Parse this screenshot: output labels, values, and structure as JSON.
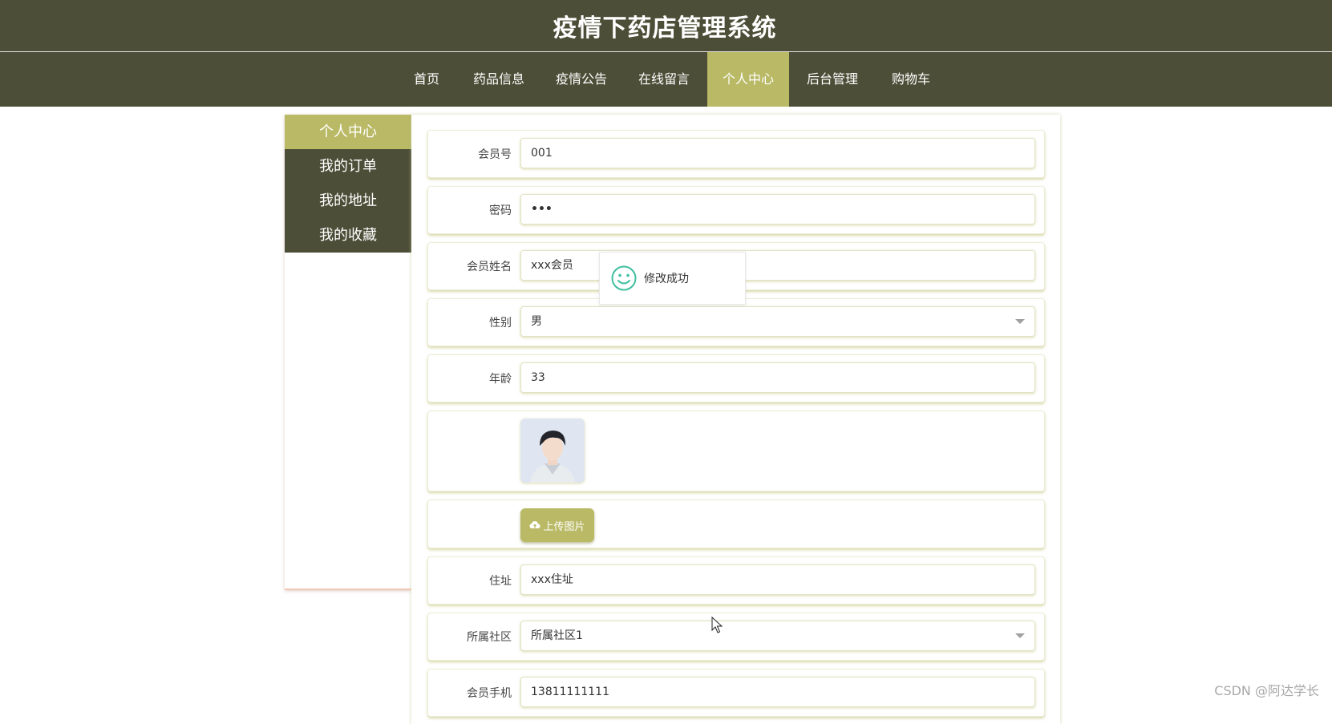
{
  "header": {
    "title": "疫情下药店管理系统"
  },
  "nav": {
    "items": [
      {
        "label": "首页"
      },
      {
        "label": "药品信息"
      },
      {
        "label": "疫情公告"
      },
      {
        "label": "在线留言"
      },
      {
        "label": "个人中心",
        "active": true
      },
      {
        "label": "后台管理"
      },
      {
        "label": "购物车"
      }
    ]
  },
  "sidebar": {
    "items": [
      {
        "label": "个人中心",
        "active": true
      },
      {
        "label": "我的订单"
      },
      {
        "label": "我的地址"
      },
      {
        "label": "我的收藏"
      }
    ]
  },
  "form": {
    "member_no": {
      "label": "会员号",
      "value": "001"
    },
    "password": {
      "label": "密码",
      "value": "•••"
    },
    "member_name": {
      "label": "会员姓名",
      "value": "xxx会员"
    },
    "gender": {
      "label": "性别",
      "value": "男"
    },
    "age": {
      "label": "年龄",
      "value": "33"
    },
    "upload": {
      "label": "上传图片"
    },
    "address": {
      "label": "住址",
      "value": "xxx住址"
    },
    "community": {
      "label": "所属社区",
      "value": "所属社区1"
    },
    "phone": {
      "label": "会员手机",
      "value": "13811111111"
    }
  },
  "toast": {
    "text": "修改成功"
  },
  "watermark": {
    "text": "CSDN @阿达学长"
  },
  "colors": {
    "header_bg": "#4c4e37",
    "accent": "#b9b966",
    "toast_icon": "#3fbf9f"
  }
}
